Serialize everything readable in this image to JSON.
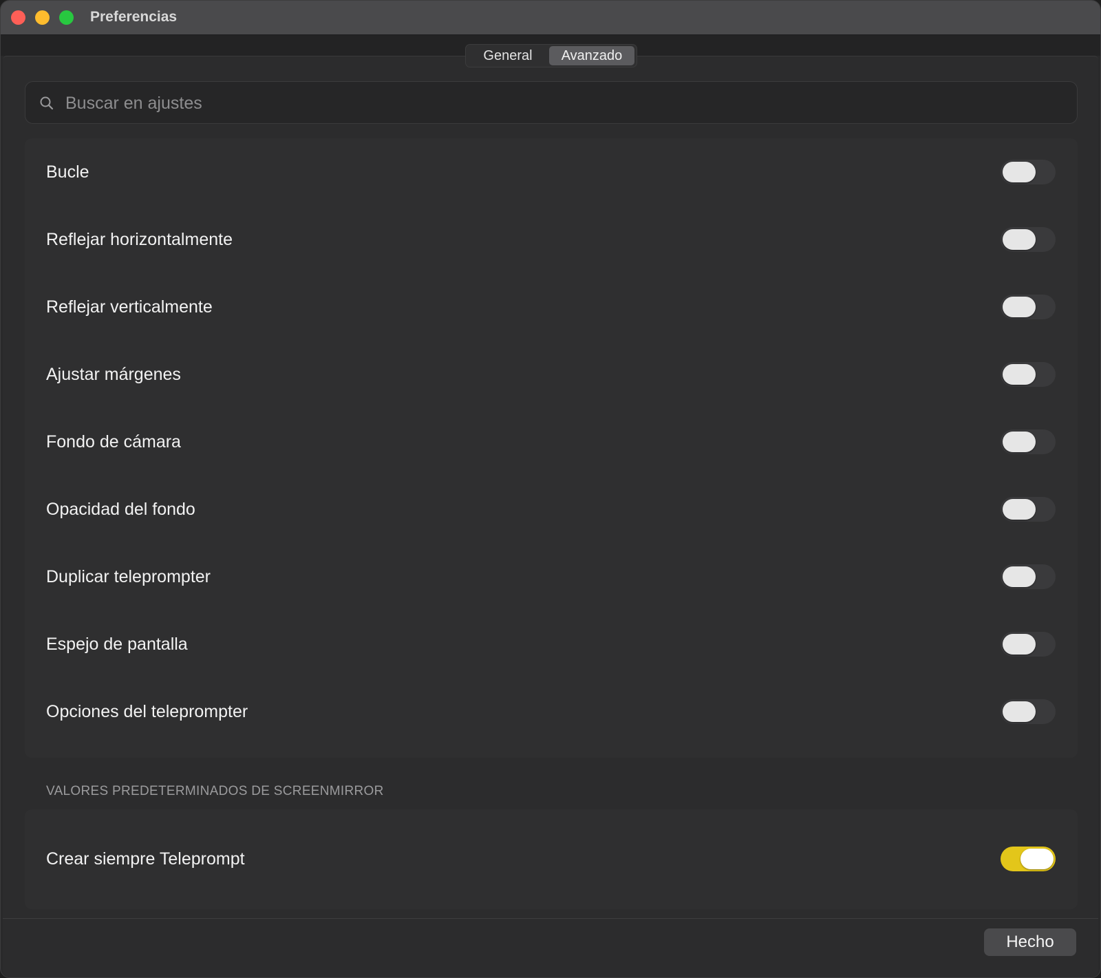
{
  "window": {
    "title": "Preferencias"
  },
  "tabs": [
    {
      "label": "General",
      "selected": false
    },
    {
      "label": "Avanzado",
      "selected": true
    }
  ],
  "search": {
    "placeholder": "Buscar en ajustes",
    "value": ""
  },
  "settings": {
    "items": [
      {
        "label": "Bucle",
        "enabled": false
      },
      {
        "label": "Reflejar horizontalmente",
        "enabled": false
      },
      {
        "label": "Reflejar verticalmente",
        "enabled": false
      },
      {
        "label": "Ajustar márgenes",
        "enabled": false
      },
      {
        "label": "Fondo de cámara",
        "enabled": false
      },
      {
        "label": "Opacidad del fondo",
        "enabled": false
      },
      {
        "label": "Duplicar teleprompter",
        "enabled": false
      },
      {
        "label": "Espejo de pantalla",
        "enabled": false
      },
      {
        "label": "Opciones del teleprompter",
        "enabled": false
      }
    ]
  },
  "screenmirror": {
    "section_title": "VALORES PREDETERMINADOS DE SCREENMIRROR",
    "items": [
      {
        "label": "Crear siempre Teleprompt",
        "enabled": true
      }
    ]
  },
  "footer": {
    "done_label": "Hecho"
  },
  "colors": {
    "toggle_on": "#e3c61a",
    "toggle_off": "#3a3a3c",
    "close": "#fe5f57",
    "minimize": "#febc2e",
    "maximize": "#28c840"
  }
}
